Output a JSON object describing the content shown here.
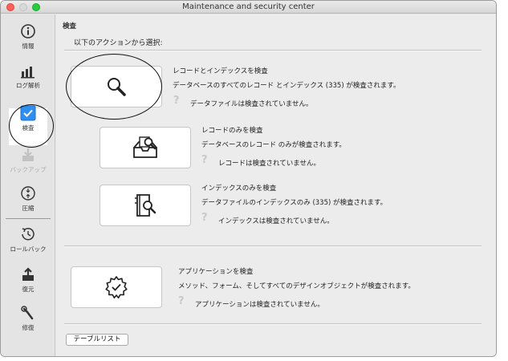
{
  "window": {
    "title": "Maintenance and security center"
  },
  "sidebar": {
    "items": [
      {
        "label": "情報",
        "icon": "info-icon"
      },
      {
        "label": "ログ解析",
        "icon": "bar-chart-icon"
      },
      {
        "label": "検査",
        "icon": "checkbox-icon",
        "selected": true
      },
      {
        "label": "バックアップ",
        "icon": "backup-icon",
        "disabled": true
      },
      {
        "label": "圧縮",
        "icon": "compress-icon"
      },
      {
        "label": "ロールバック",
        "icon": "rollback-icon"
      },
      {
        "label": "復元",
        "icon": "restore-icon"
      },
      {
        "label": "修復",
        "icon": "repair-icon"
      }
    ]
  },
  "main": {
    "section_title": "検査",
    "prompt": "以下のアクションから選択:",
    "actions": [
      {
        "title": "レコードとインデックスを検査",
        "description": "データベースのすべてのレコード とインデックス (335) が検査されます。",
        "status": "データファイルは検査されていません。",
        "icon": "magnifier-icon"
      },
      {
        "title": "レコードのみを検査",
        "description": "データベースのレコード のみが検査されます。",
        "status": "レコードは検査されていません。",
        "icon": "record-inspect-icon"
      },
      {
        "title": "インデックスのみを検査",
        "description": "データファイルのインデックスのみ (335) が検査されます。",
        "status": "インデックスは検査されていません。",
        "icon": "index-inspect-icon"
      },
      {
        "title": "アプリケーションを検査",
        "description": "メソッド、フォーム、そしてすべてのデザインオブジェクトが検査されます。",
        "status": "アプリケーションは検査されていません。",
        "icon": "gear-check-icon"
      }
    ],
    "status_icon": "?",
    "table_list_button": "テーブルリスト"
  },
  "colors": {
    "selected_checkbox": "#2d8ff2",
    "status_icon": "#c9c9c9",
    "annotation_circle": "#111111"
  }
}
